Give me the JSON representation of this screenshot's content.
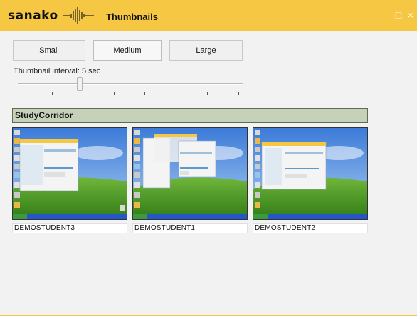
{
  "window": {
    "brand": "sanako",
    "title": "Thumbnails",
    "controls": {
      "minimize": "–",
      "maximize": "□",
      "close": "×"
    }
  },
  "size_buttons": [
    {
      "label": "Small",
      "selected": false
    },
    {
      "label": "Medium",
      "selected": true
    },
    {
      "label": "Large",
      "selected": false
    }
  ],
  "interval": {
    "label": "Thumbnail interval: 5 sec",
    "slider_level": 0.27
  },
  "group": {
    "name": "StudyCorridor",
    "students": [
      {
        "name": "DEMOSTUDENT3"
      },
      {
        "name": "DEMOSTUDENT1"
      },
      {
        "name": "DEMOSTUDENT2"
      }
    ]
  },
  "colors": {
    "accent": "#f5c742",
    "group_header": "#c6d1b9",
    "taskbar": "#2456c9"
  }
}
